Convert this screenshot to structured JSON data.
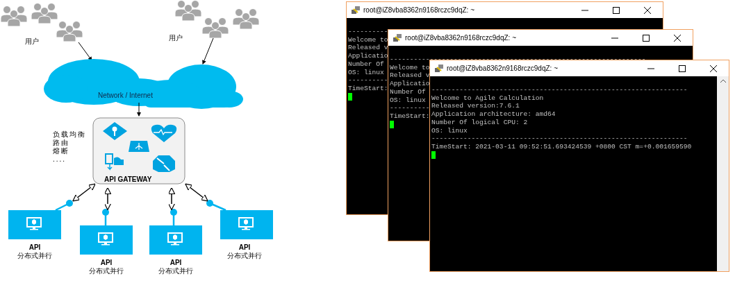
{
  "diagram": {
    "user_labels": [
      "用户",
      "用户"
    ],
    "network_label": "Network / Internet",
    "gateway_notes": [
      "负载均衡",
      "路由",
      "熔断",
      "...."
    ],
    "gateway_title": "API GATEWAY",
    "services": [
      {
        "title": "API",
        "subtitle": "分布式并行"
      },
      {
        "title": "API",
        "subtitle": "分布式并行"
      },
      {
        "title": "API",
        "subtitle": "分布式并行"
      },
      {
        "title": "API",
        "subtitle": "分布式并行"
      }
    ]
  },
  "terminals": [
    {
      "title": "root@iZ8vba8362n9168rczc9dqZ: ~",
      "lines": [
        "----------",
        "Welcome to",
        "Released v",
        "Applicatio",
        "Number Of",
        "OS: linux",
        "----------",
        "TimeStart:"
      ]
    },
    {
      "title": "root@iZ8vba8362n9168rczc9dqZ: ~",
      "lines": [
        "----------------------------------------------------------------",
        "Welcome to",
        "Released v",
        "Applicatio",
        "Number Of",
        "OS: linux",
        "----------",
        "TimeStart:"
      ]
    },
    {
      "title": "root@iZ8vba8362n9168rczc9dqZ: ~",
      "lines": [
        "----------------------------------------------------------------",
        "Welcome to Agile Calculation",
        "Released version:7.6.1",
        "Application architecture: amd64",
        "Number Of logical CPU: 2",
        "OS: linux",
        "----------------------------------------------------------------",
        "TimeStart: 2021-03-11 09:52:51.693424539 +0800 CST m=+0.001659590"
      ]
    }
  ]
}
